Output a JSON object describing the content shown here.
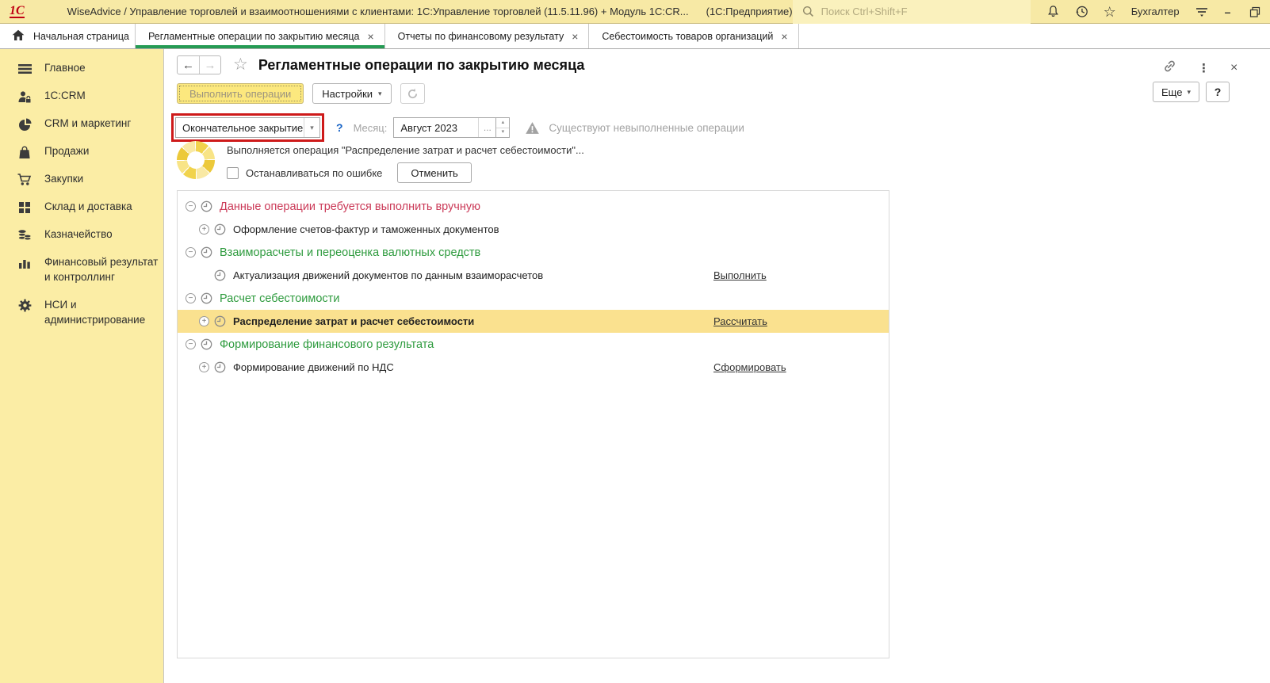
{
  "topbar": {
    "logo": "1С",
    "title": "WiseAdvice / Управление торговлей и взаимоотношениями с клиентами: 1С:Управление торговлей (11.5.11.96) + Модуль 1С:CR...",
    "app_suffix": "(1С:Предприятие)",
    "search_placeholder": "Поиск Ctrl+Shift+F",
    "user": "Бухгалтер"
  },
  "tabs": {
    "home_label": "Начальная страница",
    "items": [
      {
        "label": "Регламентные операции по закрытию месяца",
        "active": true
      },
      {
        "label": "Отчеты по финансовому результату",
        "active": false
      },
      {
        "label": "Себестоимость товаров организаций",
        "active": false
      }
    ]
  },
  "sidebar": {
    "items": [
      {
        "label": "Главное",
        "icon": "menu-lines-icon"
      },
      {
        "label": "1C:CRM",
        "icon": "person-lock-icon"
      },
      {
        "label": "CRM и маркетинг",
        "icon": "pie-chart-icon"
      },
      {
        "label": "Продажи",
        "icon": "bag-icon"
      },
      {
        "label": "Закупки",
        "icon": "cart-icon"
      },
      {
        "label": "Склад и доставка",
        "icon": "grid-icon"
      },
      {
        "label": "Казначейство",
        "icon": "coins-icon"
      },
      {
        "label": "Финансовый результат и контроллинг",
        "icon": "bar-chart-icon"
      },
      {
        "label": "НСИ и администрирование",
        "icon": "gear-icon"
      }
    ]
  },
  "page": {
    "title": "Регламентные операции по закрытию месяца",
    "more_button": "Еще",
    "help_button": "?",
    "execute_button": "Выполнить операции",
    "settings_button": "Настройки",
    "closing_type": "Окончательное закрытие",
    "help_question": "?",
    "month_label": "Месяц:",
    "month_value": "Август 2023",
    "ellipsis_button": "...",
    "warning_text": "Существуют невыполненные операции",
    "progress": {
      "text": "Выполняется операция \"Распределение затрат и расчет себестоимости\"...",
      "checkbox_label": "Останавливаться по ошибке",
      "cancel_button": "Отменить"
    },
    "operations": [
      {
        "type": "group",
        "color": "red",
        "label": "Данные операции требуется выполнить вручную",
        "expander": "minus"
      },
      {
        "type": "item",
        "label": "Оформление счетов-фактур и таможенных документов",
        "expander": "plus"
      },
      {
        "type": "group",
        "color": "green",
        "label": "Взаиморасчеты и переоценка валютных средств",
        "expander": "minus"
      },
      {
        "type": "item",
        "label": "Актуализация движений документов по данным взаиморасчетов",
        "action": "Выполнить"
      },
      {
        "type": "group",
        "color": "green",
        "label": "Расчет себестоимости",
        "expander": "minus"
      },
      {
        "type": "item",
        "label": "Распределение затрат и расчет себестоимости",
        "expander": "plus",
        "action": "Рассчитать",
        "selected": true
      },
      {
        "type": "group",
        "color": "green",
        "label": "Формирование финансового результата",
        "expander": "minus"
      },
      {
        "type": "item",
        "label": "Формирование движений по НДС",
        "expander": "plus",
        "action": "Сформировать"
      }
    ]
  },
  "icons": {
    "close": "×",
    "back": "←",
    "forward": "→",
    "star": "☆",
    "dots": "⋮",
    "dropdown": "▾",
    "up": "▴",
    "down": "▾",
    "minus": "−",
    "plus": "+",
    "minimize": "–"
  },
  "colors": {
    "topbar_bg": "#f7e9a5",
    "sidebar_bg": "#fbeda5",
    "selected_row": "#fae18f",
    "active_tab_green": "#259b54",
    "group_red": "#cb3a58",
    "group_green": "#2e9b3e",
    "annotation_red": "#ce1a1a",
    "button_yellow": "#fce87e"
  }
}
